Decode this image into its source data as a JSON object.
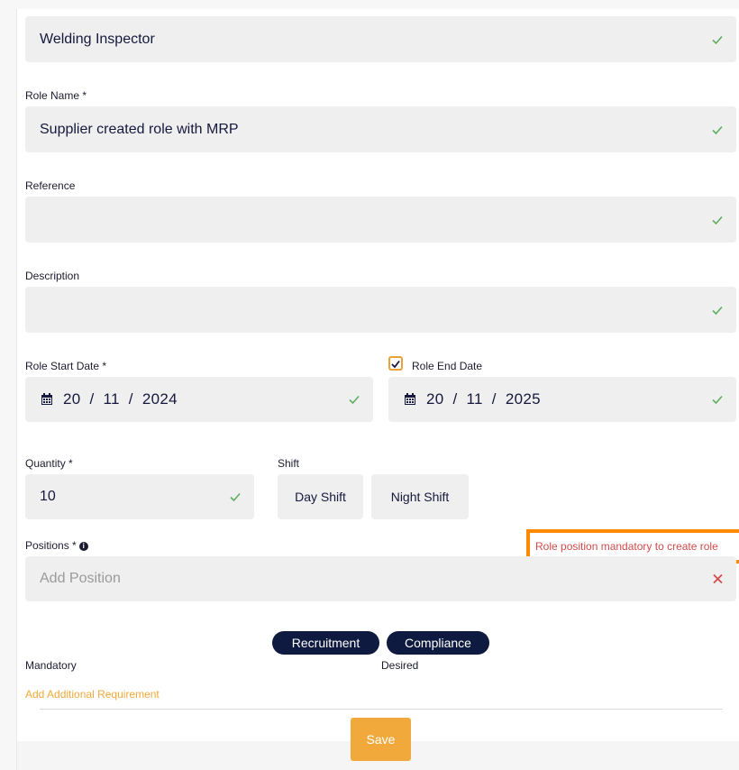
{
  "job_title": {
    "value": "Welding Inspector"
  },
  "role_name": {
    "label": "Role Name *",
    "value": "Supplier created role with MRP"
  },
  "reference": {
    "label": "Reference",
    "value": ""
  },
  "description": {
    "label": "Description",
    "value": ""
  },
  "role_start_date": {
    "label": "Role Start Date *",
    "day": "20",
    "month": "11",
    "year": "2024"
  },
  "role_end_date": {
    "label": "Role End Date",
    "checked": true,
    "day": "20",
    "month": "11",
    "year": "2025"
  },
  "quantity": {
    "label": "Quantity *",
    "value": "10"
  },
  "shift": {
    "label": "Shift",
    "options": [
      "Day Shift",
      "Night Shift"
    ]
  },
  "positions": {
    "label": "Positions *",
    "placeholder": "Add Position",
    "error": "Role position mandatory to create role"
  },
  "requirements": {
    "tags": [
      "Recruitment",
      "Compliance"
    ],
    "mandatory_label": "Mandatory",
    "desired_label": "Desired",
    "add_link": "Add Additional Requirement"
  },
  "actions": {
    "save_label": "Save"
  },
  "colors": {
    "accent": "#f2a93b",
    "navy": "#0e1a3f",
    "success": "#5fae5f",
    "error": "#d24b4b",
    "highlight": "#ff8a00"
  }
}
